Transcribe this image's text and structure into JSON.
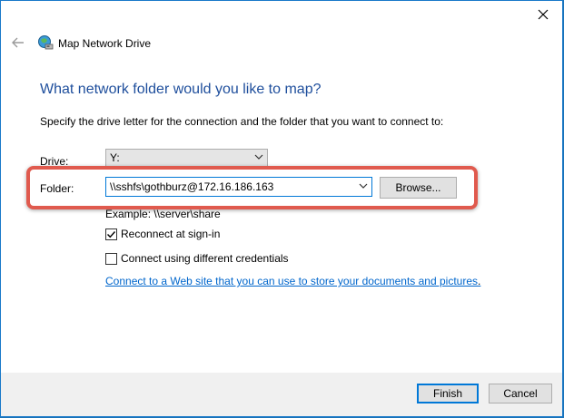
{
  "window": {
    "title": "Map Network Drive",
    "close_icon": "close-icon",
    "back_icon": "back-arrow-icon",
    "app_icon": "network-drive-icon"
  },
  "main": {
    "heading": "What network folder would you like to map?",
    "instruction": "Specify the drive letter for the connection and the folder that you want to connect to:",
    "drive_label": "Drive:",
    "drive_value": "Y:",
    "folder_label": "Folder:",
    "folder_value": "\\\\sshfs\\gothburz@172.16.186.163",
    "browse_label": "Browse...",
    "example": "Example: \\\\server\\share",
    "reconnect_label": "Reconnect at sign-in",
    "reconnect_checked": true,
    "credentials_label": "Connect using different credentials",
    "credentials_checked": false,
    "link_text": "Connect to a Web site that you can use to store your documents and pictures",
    "link_suffix": "."
  },
  "footer": {
    "finish_label": "Finish",
    "cancel_label": "Cancel"
  },
  "colors": {
    "accent": "#0078d7",
    "heading": "#1e4e9c",
    "highlight": "#e05a4e",
    "link": "#0066cc"
  }
}
